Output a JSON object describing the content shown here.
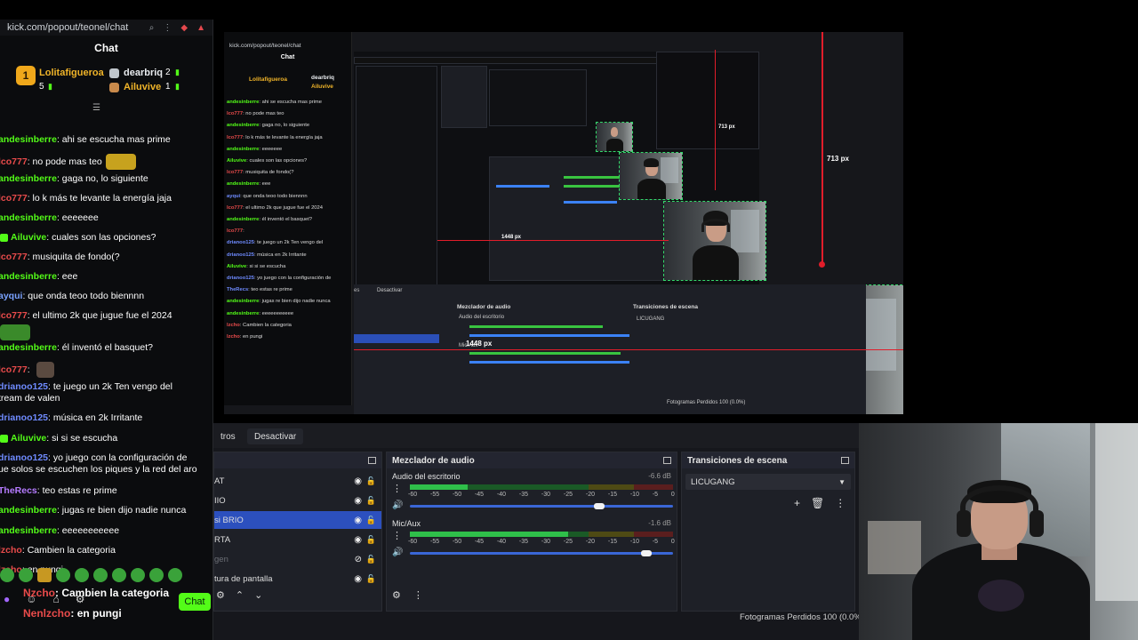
{
  "chat": {
    "url": "kick.com/popout/teonel/chat",
    "title": "Chat",
    "leaderboard": {
      "first": {
        "rank": "1",
        "name": "Lolitafigueroa",
        "points": "5"
      },
      "second": {
        "name": "dearbriq",
        "points": "2"
      },
      "third": {
        "name": "Ailuvive",
        "points": "1"
      }
    },
    "messages": [
      {
        "user": "andesinberre",
        "text": "ahi se escucha mas prime",
        "color": "#53fc18"
      },
      {
        "user": "lco777",
        "text": "no pode mas teo",
        "color": "#e94b4b"
      },
      {
        "user": "andesinberre",
        "text": "gaga no, lo siguiente",
        "color": "#53fc18"
      },
      {
        "user": "lco777",
        "text": "lo k más te levante la energía jaja",
        "color": "#e94b4b"
      },
      {
        "user": "andesinberre",
        "text": "eeeeeee",
        "color": "#53fc18"
      },
      {
        "user": "Ailuvive",
        "text": "cuales son las opciones?",
        "color": "#53fc18"
      },
      {
        "user": "lco777",
        "text": "musiquita de fondo(?",
        "color": "#e94b4b"
      },
      {
        "user": "andesinberre",
        "text": "eee",
        "color": "#53fc18"
      },
      {
        "user": "ayqui",
        "text": "que onda teoo todo biennnn",
        "color": "#7aa2ff"
      },
      {
        "user": "lco777",
        "text": "el ultimo 2k que jugue fue el 2024",
        "color": "#e94b4b"
      },
      {
        "user": "andesinberre",
        "text": "él inventó el basquet?",
        "color": "#53fc18"
      },
      {
        "user": "lco777",
        "text": "",
        "color": "#e94b4b"
      },
      {
        "user": "drianoo125",
        "text": "te juego un 2k Ten vengo del",
        "text2": "tream de valen",
        "color": "#6f8bff"
      },
      {
        "user": "drianoo125",
        "text": "música en 2k Irritante",
        "color": "#6f8bff"
      },
      {
        "user": "Ailuvive",
        "text": "si si se escucha",
        "color": "#53fc18"
      },
      {
        "user": "drianoo125",
        "text": "yo juego con la configuración de",
        "text2": "ue solos se escuchen los piques y la red del aro",
        "color": "#6f8bff"
      },
      {
        "user": "TheRecs",
        "text": "teo estas re prime",
        "color": "#b57bff"
      },
      {
        "user": "andesinberre",
        "text": "jugas re bien dijo nadie nunca",
        "color": "#53fc18"
      },
      {
        "user": "andesinberre",
        "text": "eeeeeeeeeee",
        "color": "#53fc18"
      },
      {
        "user": "lzcho",
        "text": "Cambien la categoria",
        "color": "#e94b4b"
      },
      {
        "user": "lzcho",
        "text": "en pungi",
        "color": "#e94b4b"
      }
    ],
    "pinned1": {
      "user": "Nzcho",
      "text": "Cambien la categoria"
    },
    "pinned2": {
      "user": "Nenlzcho",
      "text": "en pungi"
    },
    "send_label": "Chat"
  },
  "capture": {
    "ruler_small": "713 px",
    "ruler_big": "713 px",
    "width_label": "1448 px",
    "width_label_big": "1448 px",
    "cap_url": "kick.com/popout/teonel/chat",
    "cap_title": "Chat",
    "cap_mixer": "Mezclador de audio",
    "cap_transitions": "Transiciones de escena",
    "cap_scene": "LICUGANG",
    "cap_desactivar": "Desactivar",
    "cap_status": "Fotogramas Perdidos 100 (0.0%)",
    "cap_audio1": "Audio del escritorio",
    "cap_audio2": "Mic/Aux"
  },
  "obs": {
    "tabs": {
      "filters_partial": "tros",
      "deactivate": "Desactivar"
    },
    "sources": {
      "title": "",
      "items": [
        {
          "label": "AT",
          "visible": true
        },
        {
          "label": "IIO",
          "visible": true
        },
        {
          "label": "si BRIO",
          "visible": true,
          "selected": true
        },
        {
          "label": "RTA",
          "visible": true
        },
        {
          "label": "gen",
          "visible": false,
          "dim": true
        },
        {
          "label": "tura de pantalla",
          "visible": true
        }
      ]
    },
    "mixer": {
      "title": "Mezclador de audio",
      "channels": [
        {
          "name": "Audio del escritorio",
          "db": "-6.6 dB",
          "level": 0.22,
          "volume": 0.72
        },
        {
          "name": "Mic/Aux",
          "db": "-1.6 dB",
          "level": 0.6,
          "volume": 0.9
        }
      ],
      "ticks": [
        "-60",
        "-55",
        "-50",
        "-45",
        "-40",
        "-35",
        "-30",
        "-25",
        "-20",
        "-15",
        "-10",
        "-5",
        "0"
      ]
    },
    "transitions": {
      "title": "Transiciones de escena",
      "selected": "LICUGANG"
    },
    "status": "Fotogramas Perdidos 100 (0.0%)"
  },
  "colors": {
    "kick_green": "#53fc18",
    "obs_select": "#2c50be",
    "ruler_red": "#e11d2a"
  }
}
